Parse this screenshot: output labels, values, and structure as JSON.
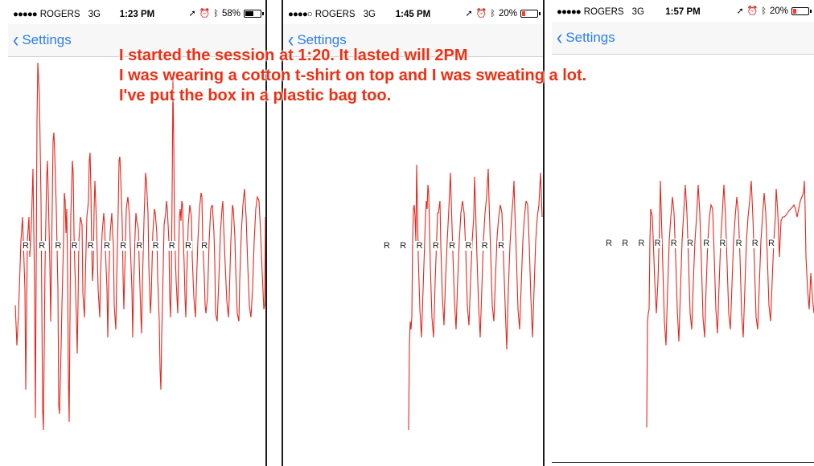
{
  "phones": [
    {
      "status": {
        "signal": "●●●●●",
        "carrier": "ROGERS",
        "network": "3G",
        "time": "1:23 PM",
        "battery_text": "58%",
        "battery_level": 0.58,
        "battery_color": "#000000"
      },
      "nav": {
        "back_label": "Settings"
      },
      "r_label": "R",
      "r_count": 12
    },
    {
      "status": {
        "signal": "●●●●○",
        "carrier": "ROGERS",
        "network": "3G",
        "time": "1:45 PM",
        "battery_text": "20%",
        "battery_level": 0.2,
        "battery_color": "#ff3b30"
      },
      "nav": {
        "back_label": "Settings"
      },
      "r_label": "R",
      "r_count": 8
    },
    {
      "status": {
        "signal": "●●●●●",
        "carrier": "ROGERS",
        "network": "3G",
        "time": "1:57 PM",
        "battery_text": "20%",
        "battery_level": 0.2,
        "battery_color": "#ff3b30"
      },
      "nav": {
        "back_label": "Settings"
      },
      "r_label": "R",
      "r_count": 11
    }
  ],
  "annotation": {
    "line1": "I started the session at 1:20. It lasted will 2PM",
    "line2": "I was wearing a cotton t-shirt on top and I was sweating a lot.",
    "line3": "I've put the box in a plastic bag too."
  },
  "icons": {
    "location": "location-arrow-icon",
    "alarm": "alarm-icon",
    "bluetooth": "bluetooth-icon",
    "battery": "battery-icon",
    "back": "chevron-left-icon"
  },
  "colors": {
    "waveform": "#e8251c",
    "accent": "#2b7ef0",
    "annotation": "#f12e12"
  }
}
